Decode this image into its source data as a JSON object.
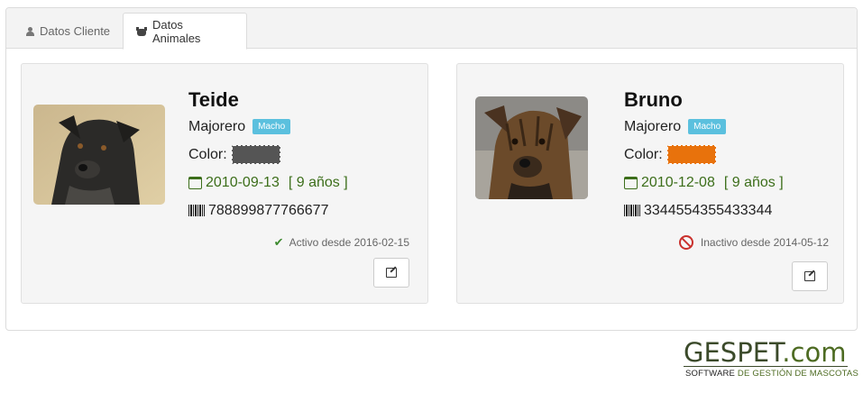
{
  "tabs": [
    {
      "label": "Datos Cliente",
      "icon": "person-icon",
      "active": false
    },
    {
      "label": "Datos Animales",
      "icon": "paw-icon",
      "active": true
    }
  ],
  "animals": [
    {
      "name": "Teide",
      "breed": "Majorero",
      "sex": "Macho",
      "color_label": "Color:",
      "color_value": "#555555",
      "birth_date": "2010-09-13",
      "age": "[ 9 años ]",
      "chip": "788899877766677",
      "status": "Activo desde 2016-02-15",
      "status_type": "active"
    },
    {
      "name": "Bruno",
      "breed": "Majorero",
      "sex": "Macho",
      "color_label": "Color:",
      "color_value": "#e8720c",
      "birth_date": "2010-12-08",
      "age": "[ 9 años ]",
      "chip": "3344554355433344",
      "status": "Inactivo desde 2014-05-12",
      "status_type": "inactive"
    }
  ],
  "branding": {
    "logo_main": "GESPET",
    "logo_suffix": ".com",
    "tagline_1": "SOFTWARE ",
    "tagline_2": "DE GESTIÓN DE MASCOTAS"
  },
  "colors": {
    "accent_green": "#3c6e1a",
    "badge_blue": "#5bc0de",
    "inactive_red": "#c9302c"
  }
}
